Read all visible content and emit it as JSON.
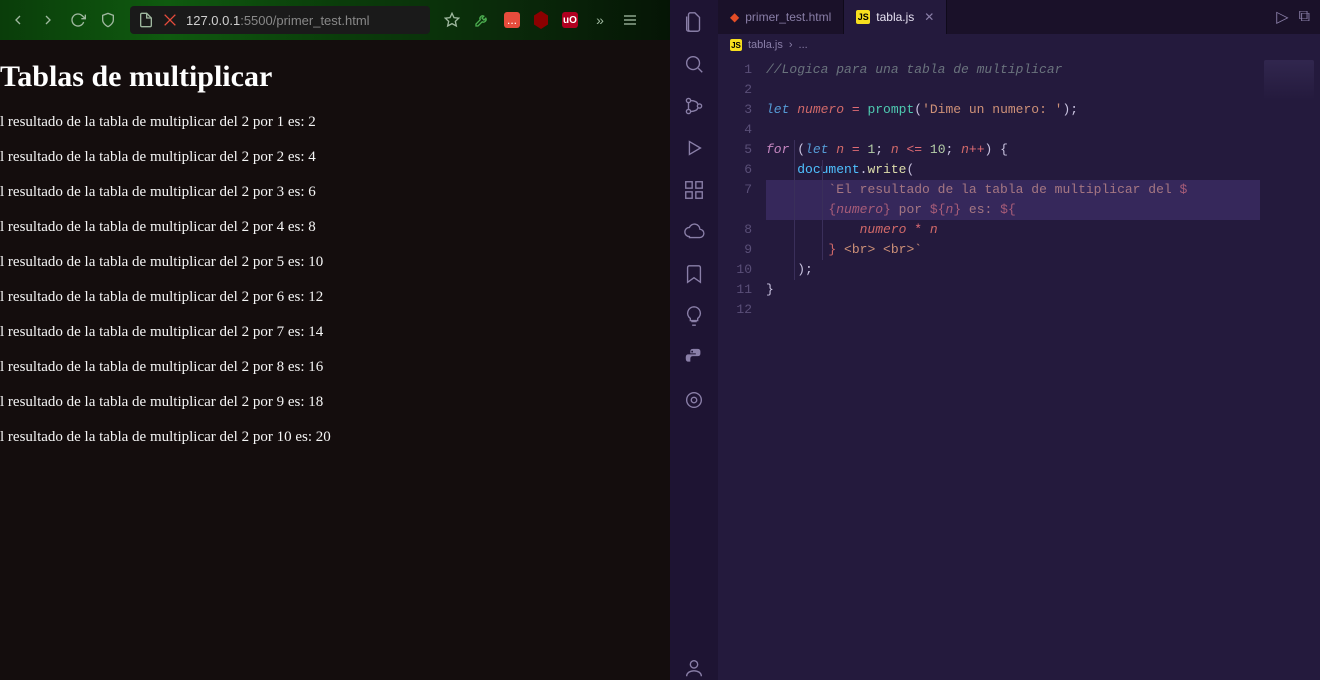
{
  "browser": {
    "url_host": "127.0.0.1",
    "url_port": ":5500",
    "url_path": "/primer_test.html",
    "toolbar_icons": {
      "back": "back",
      "forward": "forward",
      "reload": "reload",
      "shield": "shield",
      "info": "info",
      "connection": "connection",
      "bookmark": "bookmark",
      "wrench": "wrench",
      "ext_red": "...",
      "ext_adblock": "A",
      "ext_ublock": "uO",
      "overflow": ">>",
      "menu": "menu"
    }
  },
  "page": {
    "title": "Tablas de multiplicar",
    "lines": [
      "l resultado de la tabla de multiplicar del 2 por 1 es: 2",
      "l resultado de la tabla de multiplicar del 2 por 2 es: 4",
      "l resultado de la tabla de multiplicar del 2 por 3 es: 6",
      "l resultado de la tabla de multiplicar del 2 por 4 es: 8",
      "l resultado de la tabla de multiplicar del 2 por 5 es: 10",
      "l resultado de la tabla de multiplicar del 2 por 6 es: 12",
      "l resultado de la tabla de multiplicar del 2 por 7 es: 14",
      "l resultado de la tabla de multiplicar del 2 por 8 es: 16",
      "l resultado de la tabla de multiplicar del 2 por 9 es: 18",
      "l resultado de la tabla de multiplicar del 2 por 10 es: 20"
    ]
  },
  "vscode": {
    "tabs": [
      {
        "label": "primer_test.html",
        "icon": "html5",
        "active": false
      },
      {
        "label": "tabla.js",
        "icon": "js",
        "active": true
      }
    ],
    "breadcrumb": {
      "file": "tabla.js",
      "sep": "›",
      "after": "..."
    },
    "line_numbers": [
      "1",
      "2",
      "3",
      "4",
      "5",
      "6",
      "7",
      "",
      "8",
      "9",
      "10",
      "11",
      "12"
    ],
    "code": {
      "l1_comment": "//Logica para una tabla de multiplicar",
      "l3_let": "let",
      "l3_var": "numero",
      "l3_eq": " = ",
      "l3_fn": "prompt",
      "l3_arg": "'Dime un numero: '",
      "l5_for": "for",
      "l5_open": " (",
      "l5_let": "let",
      "l5_n": " n",
      "l5_eq": " = ",
      "l5_one": "1",
      "l5_semi1": "; ",
      "l5_nn": "n",
      "l5_le": " <= ",
      "l5_ten": "10",
      "l5_semi2": "; ",
      "l5_nnn": "n",
      "l5_pp": "++",
      "l5_close": ") {",
      "l6_ind": "    ",
      "l6_obj": "document",
      "l6_dot": ".",
      "l6_fn": "write",
      "l6_open": "(",
      "l7_ind": "        ",
      "l7_tick": "`",
      "l7_str1": "El resultado de la tabla de multiplicar del ",
      "l7_dollar1": "$",
      "l7b_ind": "        ",
      "l7b_open": "{",
      "l7b_var": "numero",
      "l7b_close": "}",
      "l7b_str2": " por ",
      "l7b_dollar2": "$",
      "l7b_open2": "{",
      "l7b_n": "n",
      "l7b_close2": "}",
      "l7b_str3": " es: ",
      "l7b_dollar3": "$",
      "l7b_open3": "{",
      "l8_ind": "            ",
      "l8_var": "numero",
      "l8_mul": " * ",
      "l8_n": "n",
      "l9_ind": "        ",
      "l9_close": "}",
      "l9_str": " <br> <br>",
      "l9_tick": "`",
      "l10_ind": "    ",
      "l10": ");",
      "l11": "}"
    }
  }
}
